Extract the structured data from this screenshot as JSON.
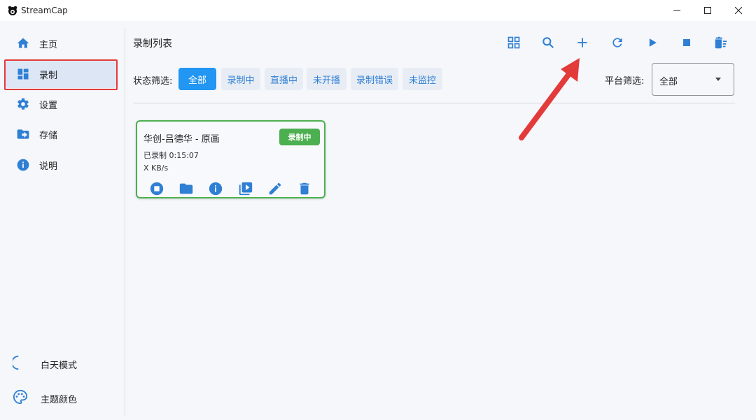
{
  "app": {
    "title": "StreamCap"
  },
  "sidebar": {
    "items": [
      {
        "label": "主页",
        "icon": "home-icon"
      },
      {
        "label": "录制",
        "icon": "dashboard-icon",
        "active": true
      },
      {
        "label": "设置",
        "icon": "gear-icon"
      },
      {
        "label": "存储",
        "icon": "folder-arrow-icon"
      },
      {
        "label": "说明",
        "icon": "info-icon"
      }
    ],
    "bottom": {
      "theme_mode": "白天模式",
      "theme_color": "主题颜色"
    }
  },
  "main": {
    "title": "录制列表",
    "filter_label": "状态筛选:",
    "filters": [
      "全部",
      "录制中",
      "直播中",
      "未开播",
      "录制错误",
      "未监控"
    ],
    "active_filter": "全部",
    "platform_label": "平台筛选:",
    "platform_value": "全部"
  },
  "card": {
    "title": "华创-吕德华 - 原画",
    "status": "录制中",
    "duration": "已录制 0:15:07",
    "speed": "X KB/s"
  },
  "colors": {
    "accent": "#2196f3",
    "recording": "#4caf50",
    "annotation": "#e33a3a"
  }
}
